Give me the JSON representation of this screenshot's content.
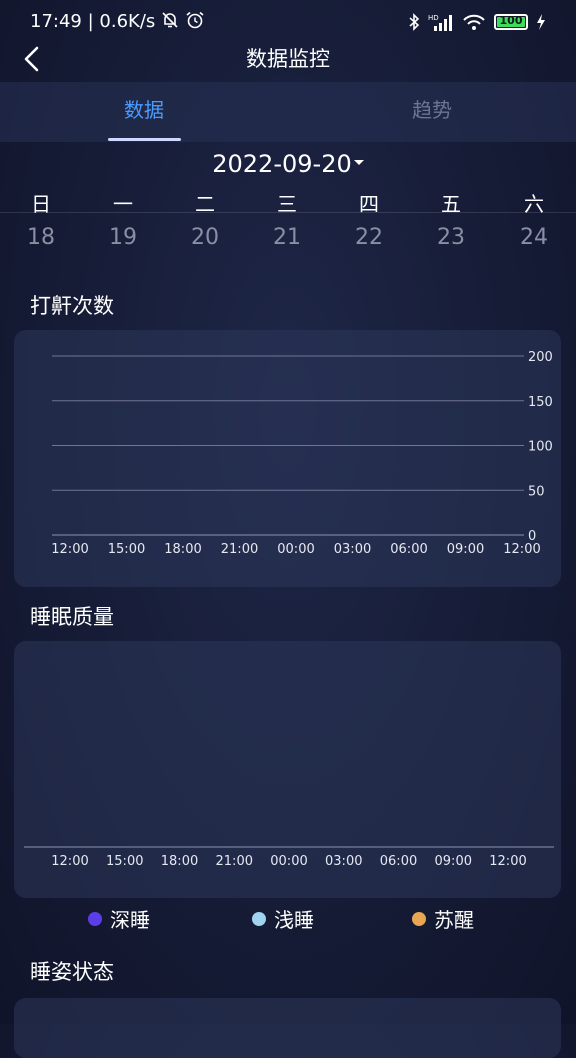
{
  "status_bar": {
    "time": "17:49",
    "network_speed": "0.6K/s",
    "battery": "100",
    "battery_level": 1.0,
    "icons": [
      "mute-bell-icon",
      "alarm-icon",
      "bluetooth-icon",
      "signal-icon",
      "wifi-icon",
      "battery-icon",
      "charging-icon"
    ]
  },
  "header": {
    "title": "数据监控"
  },
  "tabs": [
    {
      "label": "数据",
      "active": true
    },
    {
      "label": "趋势",
      "active": false
    }
  ],
  "date_picker": {
    "date": "2022-09-20"
  },
  "week": {
    "days": [
      "日",
      "一",
      "二",
      "三",
      "四",
      "五",
      "六"
    ],
    "numbers": [
      "18",
      "19",
      "20",
      "21",
      "22",
      "23",
      "24"
    ]
  },
  "snore_chart": {
    "title": "打鼾次数",
    "chart_data": {
      "type": "line",
      "x": [
        "12:00",
        "15:00",
        "18:00",
        "21:00",
        "00:00",
        "03:00",
        "06:00",
        "09:00",
        "12:00"
      ],
      "y_ticks": [
        "200",
        "150",
        "100",
        "50",
        "0"
      ],
      "ylim": [
        0,
        200
      ],
      "series": [],
      "grid": true
    }
  },
  "sleep_quality": {
    "title": "睡眠质量",
    "chart_data": {
      "type": "bar",
      "x": [
        "12:00",
        "15:00",
        "18:00",
        "21:00",
        "00:00",
        "03:00",
        "06:00",
        "09:00",
        "12:00"
      ],
      "series": []
    },
    "legend": [
      {
        "label": "深睡",
        "color": "#5b3ee8"
      },
      {
        "label": "浅睡",
        "color": "#9fd3f0"
      },
      {
        "label": "苏醒",
        "color": "#e8a552"
      }
    ]
  },
  "sleep_posture": {
    "title": "睡姿状态"
  },
  "colors": {
    "accent": "#4a9bff",
    "background": "#161c36"
  }
}
